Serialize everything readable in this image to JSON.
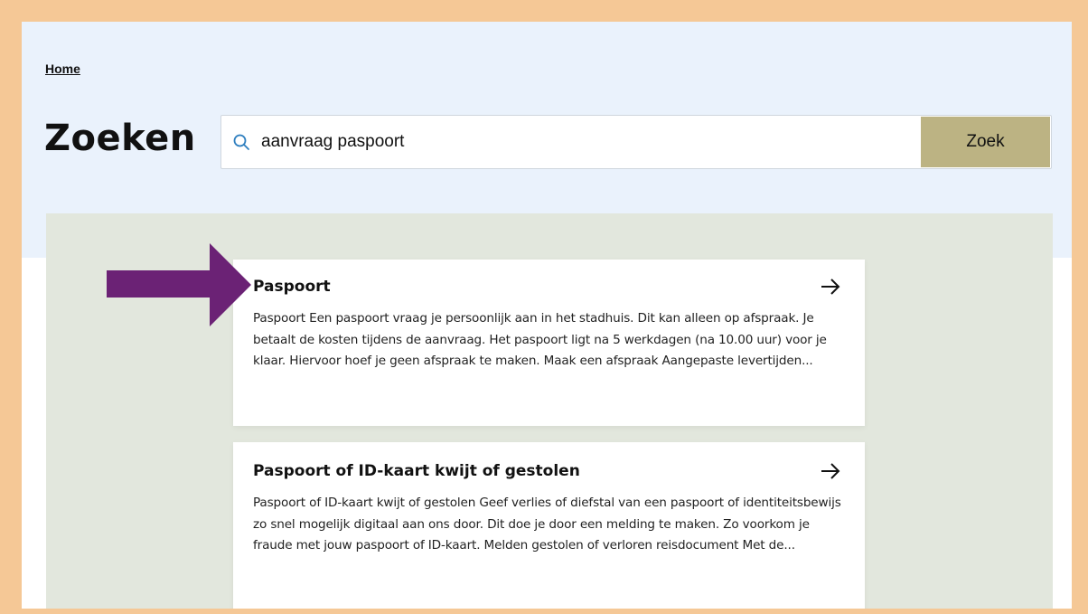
{
  "breadcrumb": {
    "home": "Home"
  },
  "page": {
    "title": "Zoeken"
  },
  "search": {
    "value": "aanvraag paspoort",
    "button_label": "Zoek",
    "icon": "search-icon"
  },
  "results": [
    {
      "title": "Paspoort",
      "snippet": "Paspoort Een paspoort vraag je persoonlijk aan in het stadhuis. Dit kan alleen op afspraak. Je betaalt de kosten tijdens de aanvraag. Het paspoort ligt na 5 werkdagen (na 10.00 uur) voor je klaar. Hiervoor hoef je geen afspraak te maken. Maak een afspraak Aangepaste levertijden...",
      "icon": "arrow-right-icon"
    },
    {
      "title": "Paspoort of ID-kaart kwijt of gestolen",
      "snippet": "Paspoort of ID-kaart kwijt of gestolen Geef verlies of diefstal van een paspoort of identiteitsbewijs zo snel mogelijk digitaal aan ons door. Dit doe je door een melding te maken. Zo voorkom je fraude met jouw paspoort of ID-kaart. Melden gestolen of verloren reisdocument Met de...",
      "icon": "arrow-right-icon"
    }
  ],
  "annotation": {
    "icon": "pointer-arrow-icon",
    "color": "#6b2275"
  },
  "colors": {
    "frame": "#f5c896",
    "hero_background": "#eaf2fc",
    "results_background": "#e2e7dd",
    "button": "#bcb383"
  }
}
